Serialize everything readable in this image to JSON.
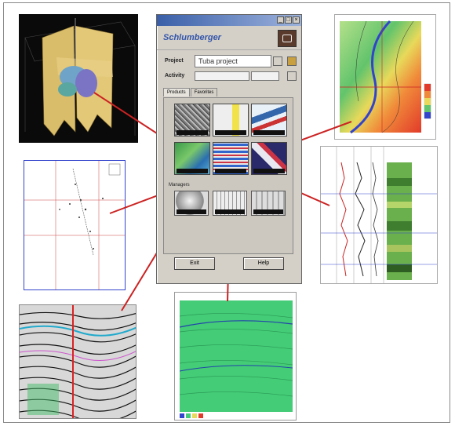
{
  "dialog": {
    "title": "",
    "brand": "Schlumberger",
    "project_label": "Project",
    "project_value": "Tuba project",
    "activity_label": "Activity",
    "activity_value": "",
    "activity_extra": "",
    "tabs": [
      {
        "label": "Products",
        "active": true
      },
      {
        "label": "Favorites",
        "active": false
      }
    ],
    "products": [
      {
        "label": "",
        "theme": "texture"
      },
      {
        "label": "",
        "theme": "yellow"
      },
      {
        "label": "",
        "theme": "layers"
      },
      {
        "label": "",
        "theme": "map"
      },
      {
        "label": "",
        "theme": "stripes"
      },
      {
        "label": "",
        "theme": "cross"
      }
    ],
    "managers_label": "Managers",
    "managers": [
      {
        "label": "",
        "theme": "sphere"
      },
      {
        "label": "",
        "theme": "grid"
      },
      {
        "label": "",
        "theme": "columns"
      }
    ],
    "buttons": {
      "exit": "Exit",
      "help": "Help"
    }
  },
  "colors": {
    "connector": "#cc2222",
    "dialog_bg": "#d4d0c8",
    "brand": "#3355aa",
    "seismic_green": "#44cc77",
    "basemap_blue": "#3344cc"
  },
  "panels": [
    {
      "id": "3d-volume",
      "kind": "3d-view"
    },
    {
      "id": "contour-map",
      "kind": "contour-map"
    },
    {
      "id": "well-logs",
      "kind": "well-log-plot"
    },
    {
      "id": "basemap",
      "kind": "basemap"
    },
    {
      "id": "seismic-section",
      "kind": "seismic-section"
    },
    {
      "id": "seismic-interpretation",
      "kind": "seismic-interpretation"
    }
  ]
}
